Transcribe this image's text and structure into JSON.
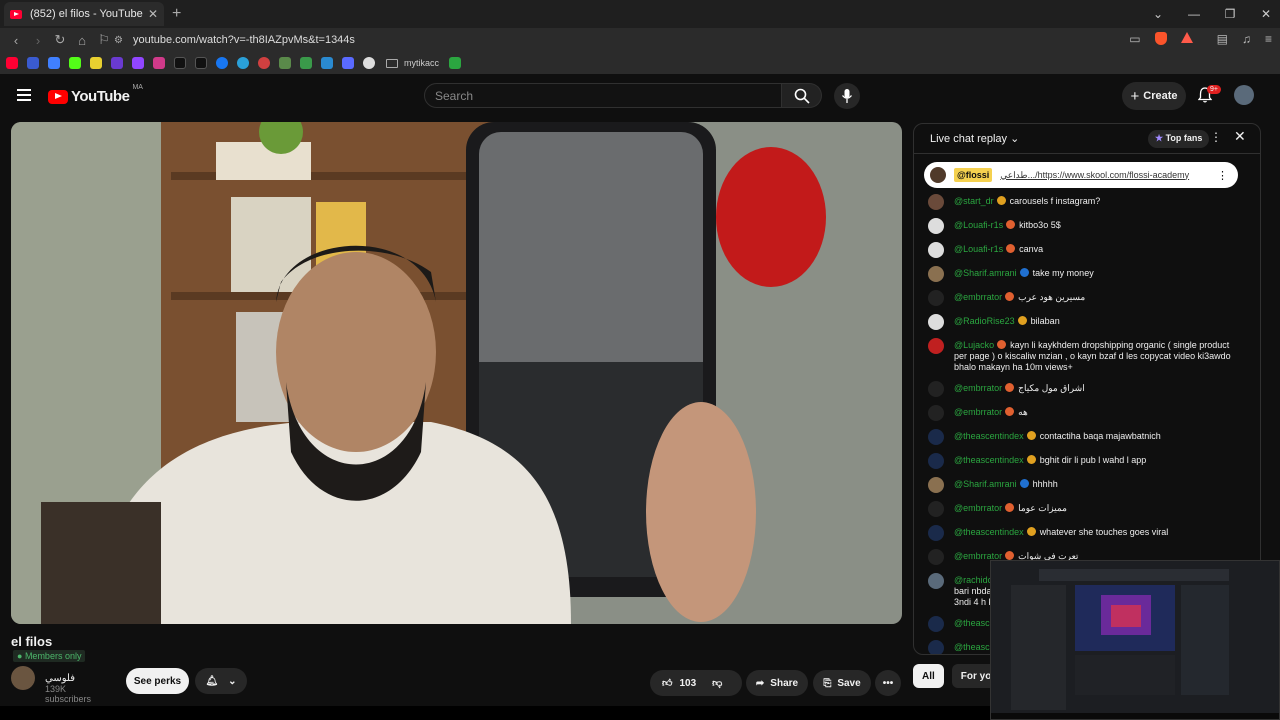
{
  "browser": {
    "tab_title": "(852) el filos - YouTube",
    "url": "youtube.com/watch?v=-th8IAZpvMs&t=1344s",
    "bookmark_folder": "mytikacc"
  },
  "header": {
    "logo_text": "YouTube",
    "country_code": "MA",
    "search_placeholder": "Search",
    "create_label": "Create",
    "notification_count": "9+"
  },
  "video": {
    "title": "el filos",
    "members_label": "Members only",
    "channel_name": "فلوسي",
    "subscribers": "139K subscribers",
    "see_perks": "See perks",
    "likes": "103",
    "share": "Share",
    "save": "Save"
  },
  "chat": {
    "title": "Live chat replay",
    "top_fans": "Top fans",
    "pinned": {
      "author": "@flossi",
      "text": "طداعي.../https://www.skool.com/flossi-academy"
    },
    "messages": [
      {
        "author": "@start_dr",
        "text": "carousels f instagram?",
        "color": "#6a4a3a",
        "badge": "#e0a020"
      },
      {
        "author": "@Louafi-r1s",
        "text": "kitbo3o 5$",
        "color": "#ddd",
        "badge": "#e06030"
      },
      {
        "author": "@Louafi-r1s",
        "text": "canva",
        "color": "#ddd",
        "badge": "#e06030"
      },
      {
        "author": "@Sharif.amrani",
        "text": "take my money",
        "color": "#8a7050",
        "badge": "#2070d0"
      },
      {
        "author": "@embrrator",
        "text": "مسيرين هود عرب",
        "color": "#222",
        "badge": "#e06030"
      },
      {
        "author": "@RadioRise23",
        "text": "bilaban",
        "color": "#ddd",
        "badge": "#e0a020"
      },
      {
        "author": "@Lujacko",
        "text": "kayn li kaykhdem dropshipping organic ( single product per page ) o kiscaliw mzian , o kayn bzaf d les copycat video ki3awdo bhalo makayn ha 10m views+",
        "color": "#c02020",
        "badge": "#e06030"
      },
      {
        "author": "@embrrator",
        "text": "اشراق مول مكياج",
        "color": "#222",
        "badge": "#e06030"
      },
      {
        "author": "@embrrator",
        "text": "هه",
        "color": "#222",
        "badge": "#e06030"
      },
      {
        "author": "@theascentindex",
        "text": "contactiha baqa majawbatnich",
        "color": "#1a2a4a",
        "badge": "#e0a020"
      },
      {
        "author": "@theascentindex",
        "text": "bghit dir li pub l wahd l app",
        "color": "#1a2a4a",
        "badge": "#e0a020"
      },
      {
        "author": "@Sharif.amrani",
        "text": "hhhhh",
        "color": "#8a7050",
        "badge": "#2070d0"
      },
      {
        "author": "@embrrator",
        "text": "مميزات عوما",
        "color": "#222",
        "badge": "#e06030"
      },
      {
        "author": "@theascentindex",
        "text": "whatever she touches goes viral",
        "color": "#1a2a4a",
        "badge": "#e0a020"
      },
      {
        "author": "@embrrator",
        "text": "تعرت في شوات",
        "color": "#222",
        "badge": "#e06030"
      },
      {
        "author": "@rachidoujaa391",
        "text": "ana 3ndi 23 3am o 14000 dh kan9a handassa bari nbda nt3lm chi7aja m3ndich mochkil nt3lm l modat 6 mois tal 3am 3ndi 4 h khawyin f nhar",
        "color": "#5a6a7a",
        "badge": "#2070d0"
      },
      {
        "author": "@theasc",
        "text": "",
        "color": "#1a2a4a",
        "badge": "#e0a020"
      },
      {
        "author": "@theasc",
        "text": "daba",
        "color": "#1a2a4a",
        "badge": "#e0a020"
      },
      {
        "author": "@embr",
        "text": "",
        "color": "#222",
        "badge": "#e06030"
      },
      {
        "author": "@MIKAS",
        "text": "",
        "color": "#6a2a2a",
        "badge": "#e06030"
      }
    ],
    "chips": [
      "All",
      "For you"
    ]
  }
}
